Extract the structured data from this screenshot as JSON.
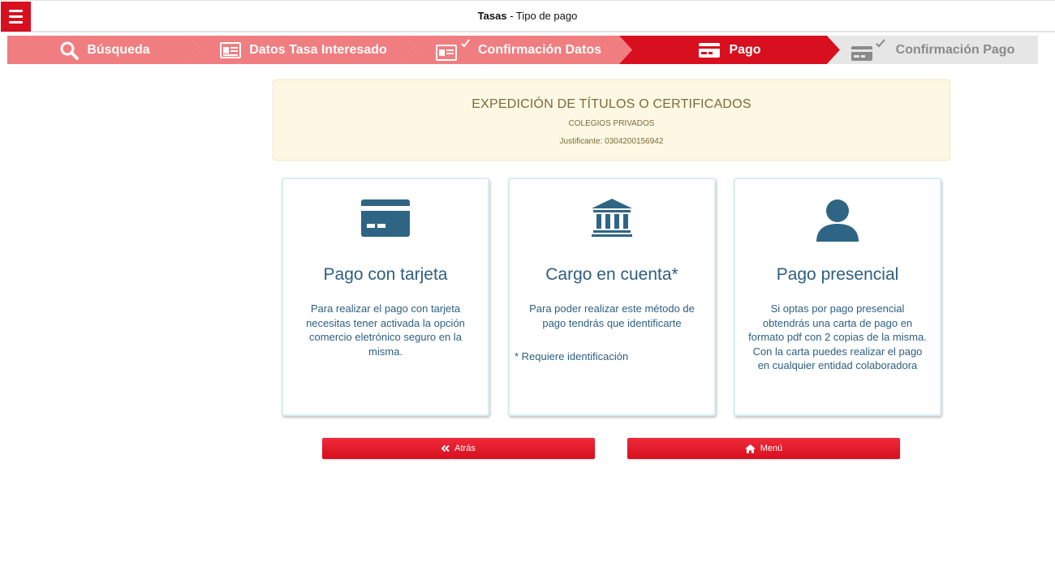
{
  "header": {
    "title_bold": "Tasas",
    "title_rest": " - Tipo de pago",
    "menu_icon": "hamburger-icon"
  },
  "steps": [
    {
      "label": "Búsqueda",
      "icon": "search-icon",
      "state": "done"
    },
    {
      "label": "Datos Tasa Interesado",
      "icon": "id-card-icon",
      "state": "done"
    },
    {
      "label": "Confirmación Datos",
      "icon": "id-card-check-icon",
      "state": "done"
    },
    {
      "label": "Pago",
      "icon": "credit-card-icon",
      "state": "active"
    },
    {
      "label": "Confirmación Pago",
      "icon": "credit-card-check-icon",
      "state": "pending"
    }
  ],
  "colors": {
    "accent": "#d70f1e",
    "step_done": "#f07d80",
    "step_pending": "#e6e6e6",
    "card_text": "#2d5f80"
  },
  "info": {
    "title": "EXPEDICIÓN DE TÍTULOS O CERTIFICADOS",
    "subtitle": "COLEGIOS PRIVADOS",
    "justificante": "Justificante: 0304200156942"
  },
  "cards": [
    {
      "icon": "credit-card-icon",
      "title": "Pago con tarjeta",
      "description": "Para realizar el pago con tarjeta necesitas tener activada la opción comercio eletrónico seguro en la misma.",
      "note": ""
    },
    {
      "icon": "bank-icon",
      "title": "Cargo en cuenta*",
      "description": "Para poder realizar este método de pago tendrás que identificarte",
      "note": "* Requiere identificación"
    },
    {
      "icon": "user-icon",
      "title": "Pago presencial",
      "description": "Si optas por pago presencial obtendrás una carta de pago en formato pdf con 2 copias de la misma. Con la carta puedes realizar el pago en cualquier entidad colaboradora",
      "note": ""
    }
  ],
  "buttons": {
    "back_label": "Atrás",
    "back_icon": "double-chevron-left-icon",
    "menu_label": "Menú",
    "menu_icon": "home-icon"
  }
}
